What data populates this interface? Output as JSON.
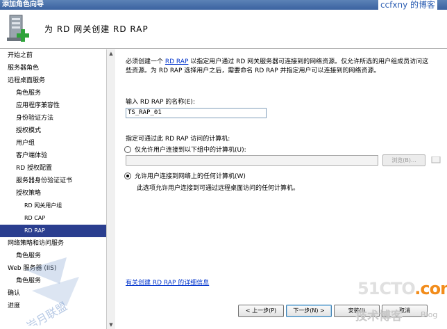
{
  "window": {
    "title": "添加角色向导"
  },
  "watermark_top": "ccfxny 的博客",
  "header": {
    "title": "为 RD 网关创建 RD RAP"
  },
  "nav": {
    "items": [
      {
        "label": "开始之前",
        "level": 0,
        "selected": false
      },
      {
        "label": "服务器角色",
        "level": 0,
        "selected": false
      },
      {
        "label": "远程桌面服务",
        "level": 0,
        "selected": false
      },
      {
        "label": "角色服务",
        "level": 1,
        "selected": false
      },
      {
        "label": "应用程序兼容性",
        "level": 1,
        "selected": false
      },
      {
        "label": "身份验证方法",
        "level": 1,
        "selected": false
      },
      {
        "label": "授权模式",
        "level": 1,
        "selected": false
      },
      {
        "label": "用户组",
        "level": 1,
        "selected": false
      },
      {
        "label": "客户端体验",
        "level": 1,
        "selected": false
      },
      {
        "label": "RD 授权配置",
        "level": 1,
        "selected": false
      },
      {
        "label": "服务器身份验证证书",
        "level": 1,
        "selected": false
      },
      {
        "label": "授权策略",
        "level": 1,
        "selected": false
      },
      {
        "label": "RD 网关用户组",
        "level": 2,
        "selected": false
      },
      {
        "label": "RD CAP",
        "level": 2,
        "selected": false
      },
      {
        "label": "RD RAP",
        "level": 2,
        "selected": true
      },
      {
        "label": "网络策略和访问服务",
        "level": 0,
        "selected": false
      },
      {
        "label": "角色服务",
        "level": 1,
        "selected": false
      },
      {
        "label": "Web 服务器 (IIS)",
        "level": 0,
        "selected": false
      },
      {
        "label": "角色服务",
        "level": 1,
        "selected": false
      },
      {
        "label": "确认",
        "level": 0,
        "selected": false
      },
      {
        "label": "进度",
        "level": 0,
        "selected": false
      }
    ]
  },
  "main": {
    "desc_prefix": "必须创建一个 ",
    "desc_link": "RD RAP",
    "desc_suffix": " 以指定用户通过 RD 网关服务器可连接到的网络资源。仅允许所选的用户组成员访问这些资源。为 RD RAP 选择用户之后，需要命名 RD RAP 并指定用户可以连接到的网络资源。",
    "name_label": "输入 RD RAP 的名称(E):",
    "name_value": "TS_RAP_01",
    "access_label": "指定可通过此 RD RAP 访问的计算机:",
    "radio_group_label": "仅允许用户连接到以下组中的计算机(U):",
    "browse_label": "浏览(B)...",
    "radio_any_label": "允许用户连接到网络上的任何计算机(W)",
    "any_note": "此选项允许用户连接到可通过远程桌面访问的任何计算机。",
    "more_info_link": "有关创建 RD RAP 的详细信息"
  },
  "buttons": {
    "back": "< 上一步(P)",
    "next": "下一步(N) >",
    "install": "安装(I)",
    "cancel": "取消"
  },
  "watermarks": {
    "logo_51": "51CTO",
    "logo_com": ".com",
    "logo_tech": "技术博客",
    "logo_blog": "Blog",
    "cn_watermark": "岩月联盟"
  }
}
